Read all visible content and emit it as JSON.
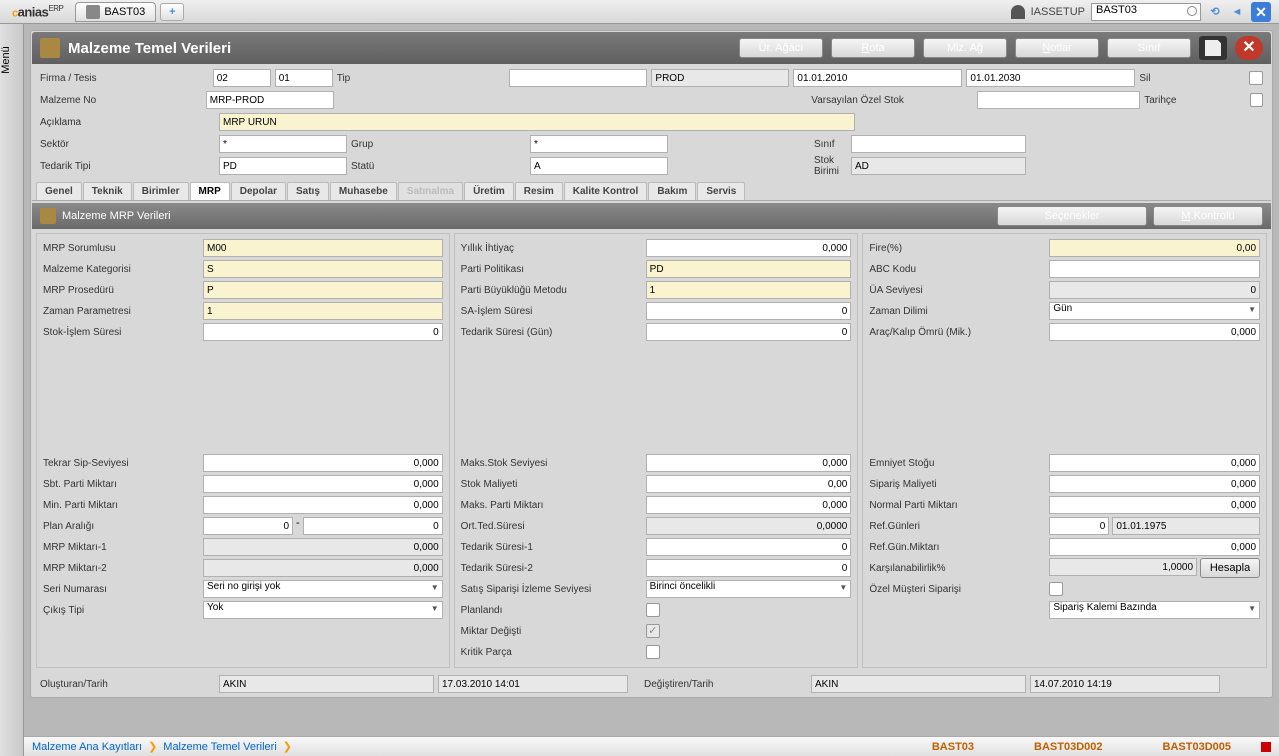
{
  "top": {
    "tab": "BAST03",
    "plus": "+",
    "user": "IASSETUP",
    "search": "BAST03"
  },
  "title": "Malzeme Temel Verileri",
  "hbtns": {
    "urAgaci": "Ür. Ağacı",
    "rota": "Rota",
    "mlzAg": "Mlz. Ağ",
    "notlar": "Notlar",
    "sinif": "Sınıf"
  },
  "hdr": {
    "firmaTesis": "Firma / Tesis",
    "firma": "02",
    "tesis": "01",
    "tipL": "Tip",
    "tip": "",
    "prod": "PROD",
    "d1": "01.01.2010",
    "d2": "01.01.2030",
    "silL": "Sil",
    "malzNoL": "Malzeme No",
    "malzNo": "MRP-PROD",
    "varsL": "Varsayılan Özel Stok",
    "vars": "",
    "tarihceL": "Tarihçe",
    "aciklamaL": "Açıklama",
    "aciklama": "MRP URUN",
    "sektorL": "Sektör",
    "sektor": "*",
    "grupL": "Grup",
    "grup": "*",
    "sinifL": "Sınıf",
    "sinif": "",
    "tedTipL": "Tedarik Tipi",
    "tedTip": "PD",
    "statuL": "Statü",
    "statu": "A",
    "stokBirL": "Stok Birimi",
    "stokBir": "AD"
  },
  "tabs": [
    "Genel",
    "Teknik",
    "Birimler",
    "MRP",
    "Depolar",
    "Satış",
    "Muhasebe",
    "Satınalma",
    "Üretim",
    "Resim",
    "Kalite Kontrol",
    "Bakım",
    "Servis"
  ],
  "sub": {
    "title": "Malzeme MRP Verileri",
    "secenekler": "Seçenekler",
    "mkontrol": "M.Kontrolü"
  },
  "c1": {
    "mrpSorL": "MRP Sorumlusu",
    "mrpSor": "M00",
    "malzKatL": "Malzeme Kategorisi",
    "malzKat": "S",
    "mrpProsL": "MRP Prosedürü",
    "mrpPros": "P",
    "zamParL": "Zaman Parametresi",
    "zamPar": "1",
    "stokIslL": "Stok-İşlem Süresi",
    "stokIsl": "0",
    "tekSipL": "Tekrar Sip-Seviyesi",
    "tekSip": "0,000",
    "sbtPartL": "Sbt. Parti Miktarı",
    "sbtPart": "0,000",
    "minPartL": "Min. Parti Miktarı",
    "minPart": "0,000",
    "planArL": "Plan Aralığı",
    "planAr1": "0",
    "dash": "-",
    "planAr2": "0",
    "mrpM1L": "MRP Miktarı-1",
    "mrpM1": "0,000",
    "mrpM2L": "MRP Miktarı-2",
    "mrpM2": "0,000",
    "seriNoL": "Seri Numarası",
    "seriNo": "Seri no girişi yok",
    "cikisL": "Çıkış Tipi",
    "cikis": "Yok"
  },
  "c2": {
    "yilIhtL": "Yıllık İhtiyaç",
    "yilIht": "0,000",
    "partPolL": "Parti Politikası",
    "partPol": "PD",
    "partBuyL": "Parti Büyüklüğü Metodu",
    "partBuy": "1",
    "saIslL": "SA-İşlem Süresi",
    "saIsl": "0",
    "tedSurL": "Tedarik Süresi (Gün)",
    "tedSur": "0",
    "maksStokL": "Maks.Stok Seviyesi",
    "maksStok": "0,000",
    "stokMalL": "Stok Maliyeti",
    "stokMal": "0,00",
    "maksPartL": "Maks. Parti Miktarı",
    "maksPart": "0,000",
    "ortTedL": "Ort.Ted.Süresi",
    "ortTed": "0,0000",
    "tedSur1L": "Tedarik Süresi-1",
    "tedSur1": "0",
    "tedSur2L": "Tedarik Süresi-2",
    "tedSur2": "0",
    "satSipL": "Satış Siparişi İzleme Seviyesi",
    "satSip": "Birinci öncelikli",
    "planL": "Planlandı",
    "mikDegL": "Miktar Değişti",
    "kritPL": "Kritik Parça"
  },
  "c3": {
    "fireL": "Fire(%)",
    "fire": "0,00",
    "abcL": "ABC Kodu",
    "abc": "",
    "uaSevL": "ÜA Seviyesi",
    "uaSev": "0",
    "zamDilL": "Zaman Dilimi",
    "zamDil": "Gün",
    "aracKalL": "Araç/Kalıp Ömrü (Mik.)",
    "aracKal": "0,000",
    "emnStokL": "Emniyet Stoğu",
    "emnStok": "0,000",
    "sipMalL": "Sipariş Maliyeti",
    "sipMal": "0,000",
    "normPartL": "Normal Parti Miktarı",
    "normPart": "0,000",
    "refGunL": "Ref.Günleri",
    "refGun": "0",
    "refGunD": "01.01.1975",
    "refGunML": "Ref.Gün.Miktarı",
    "refGunM": "0,000",
    "karsL": "Karşılanabilirlik%",
    "kars": "1,0000",
    "hesapla": "Hesapla",
    "ozMusL": "Özel Müşteri Siparişi",
    "sipKalL": "",
    "sipKal": "Sipariş Kalemi Bazında"
  },
  "footer": {
    "olL": "Oluşturan/Tarih",
    "olU": "AKIN",
    "olD": "17.03.2010 14:01",
    "degL": "Değiştiren/Tarih",
    "degU": "AKIN",
    "degD": "14.07.2010 14:19"
  },
  "status": {
    "c1": "Malzeme Ana Kayıtları",
    "c2": "Malzeme Temel Verileri",
    "s1": "BAST03",
    "s2": "BAST03D002",
    "s3": "BAST03D005"
  },
  "menuL": "Menü"
}
